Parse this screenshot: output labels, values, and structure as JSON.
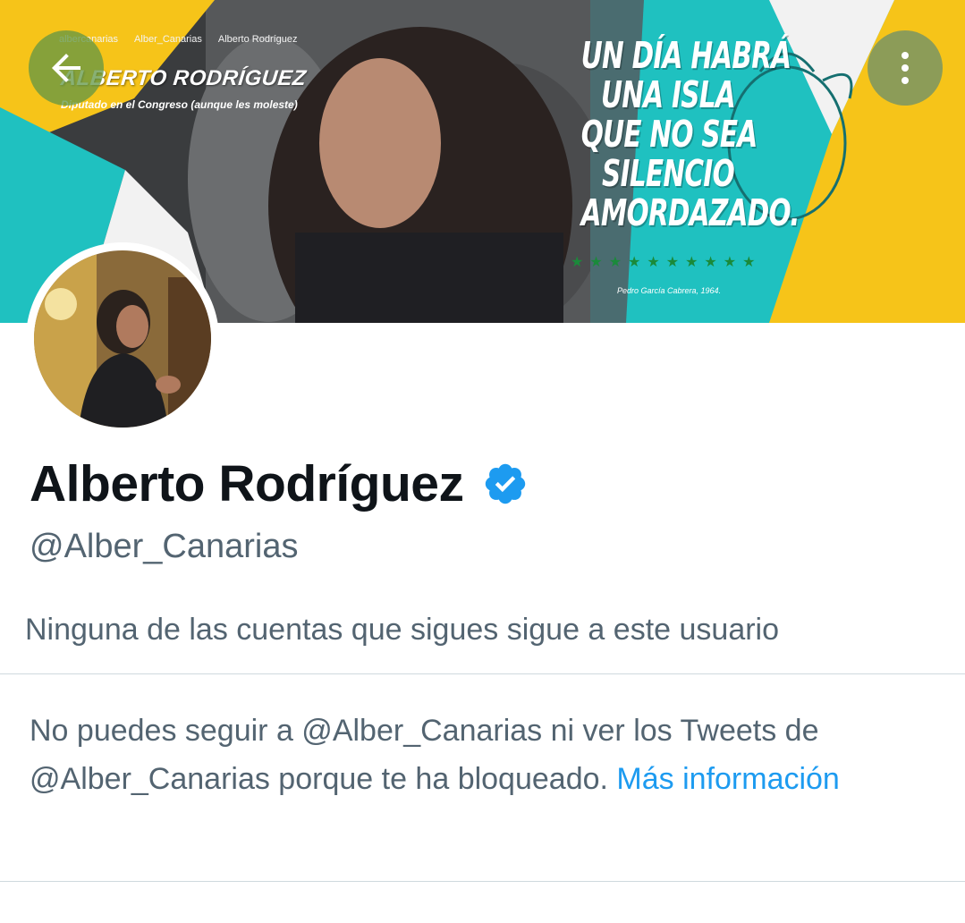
{
  "header": {
    "back_icon": "arrow-left-icon",
    "more_icon": "more-vertical-icon"
  },
  "banner": {
    "social_instagram": "albercanarias",
    "social_twitter": "Alber_Canarias",
    "social_facebook": "Alberto Rodríguez",
    "name": "ALBERTO RODRÍGUEZ",
    "subtitle": "Diputado en el Congreso (aunque les moleste)",
    "quote_lines": [
      "UN DÍA HABRÁ",
      "UNA ISLA",
      "QUE NO SEA",
      "SILENCIO",
      "AMORDAZADO."
    ],
    "quote_author": "Pedro García Cabrera, 1964.",
    "stars": "★★★★★★★★★★",
    "colors": {
      "teal": "#1fc1c0",
      "yellow": "#f6c419",
      "white": "#f2f2f2"
    }
  },
  "profile": {
    "display_name": "Alberto Rodríguez",
    "verified_icon": "verified-badge-icon",
    "handle": "@Alber_Canarias",
    "followers_note": "Ninguna de las cuentas que sigues sigue a este usuario"
  },
  "blocked": {
    "message": "No puedes seguir a @Alber_Canarias ni ver los Tweets de @Alber_Canarias porque te ha bloqueado.",
    "link_label": "Más información"
  },
  "colors": {
    "text_primary": "#0f1419",
    "text_secondary": "#536471",
    "link": "#1d9bf0",
    "verified": "#1d9bf0"
  }
}
